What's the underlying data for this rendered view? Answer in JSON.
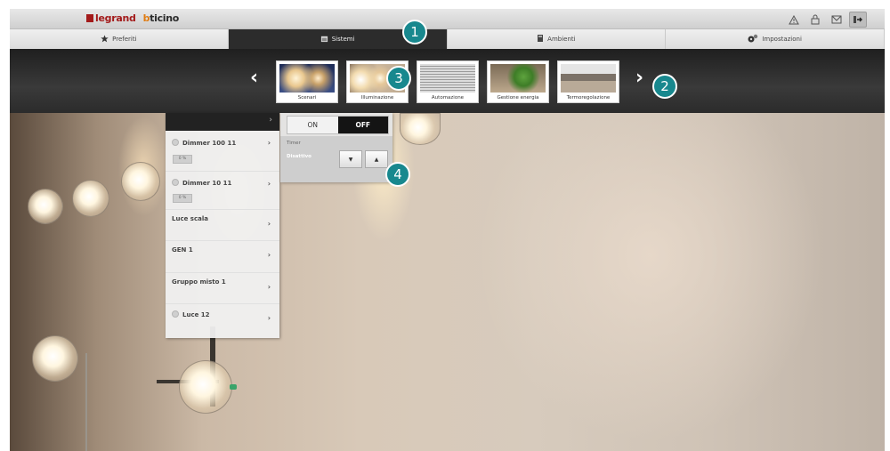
{
  "brand": {
    "legrand": "legrand",
    "bticino": "bticino",
    "bticino_first": "b",
    "bticino_rest": "ticino"
  },
  "topbar": {
    "icons": [
      "alert-triangle-icon",
      "lock-icon",
      "mail-icon",
      "exit-icon"
    ]
  },
  "tabs": [
    {
      "label": "Preferiti",
      "icon": "star-icon",
      "active": false
    },
    {
      "label": "Sistemi",
      "icon": "system-icon",
      "active": true
    },
    {
      "label": "Ambienti",
      "icon": "room-icon",
      "active": false
    },
    {
      "label": "Impostazioni",
      "icon": "settings-icon",
      "active": false
    }
  ],
  "carousel": {
    "prev": "‹",
    "next": "›",
    "items": [
      {
        "label": "Scenari",
        "icon": "scenarios-icon"
      },
      {
        "label": "Illuminazione",
        "icon": "lighting-icon"
      },
      {
        "label": "Automazione",
        "icon": "automation-icon"
      },
      {
        "label": "Gestione energia",
        "icon": "energy-icon"
      },
      {
        "label": "Termoregolazione",
        "icon": "thermoregulation-icon"
      }
    ]
  },
  "devices": [
    {
      "name": "Dimmer 100 11",
      "has_dot": true,
      "level": "0 %"
    },
    {
      "name": "Dimmer 10 11",
      "has_dot": true,
      "level": "0 %"
    },
    {
      "name": "Luce scala",
      "has_dot": false
    },
    {
      "name": "GEN 1",
      "has_dot": false
    },
    {
      "name": "Gruppo misto 1",
      "has_dot": false
    },
    {
      "name": "Luce 12",
      "has_dot": true
    }
  ],
  "control": {
    "on_label": "ON",
    "off_label": "OFF",
    "timer_label": "Timer",
    "timer_value": "Disattivo",
    "down_label": "▼",
    "up_label": "▲"
  },
  "callouts": [
    "1",
    "2",
    "3",
    "4"
  ],
  "colors": {
    "accent": "#18888e",
    "brand_red": "#a31b1b",
    "active_tab": "#2c2c2c"
  }
}
